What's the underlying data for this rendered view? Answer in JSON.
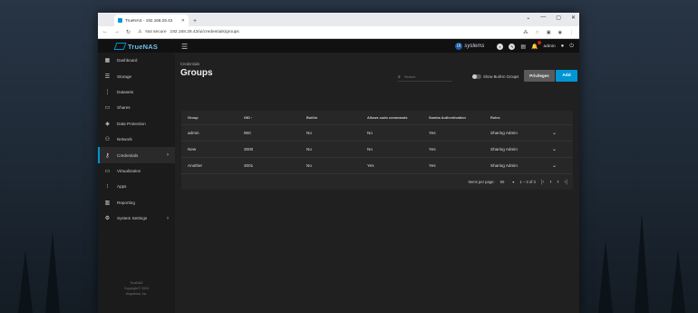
{
  "browser": {
    "tab_title": "TrueNAS - 192.168.29.43",
    "new_tab": "+",
    "window_controls": [
      "⌄",
      "—",
      "▢",
      "✕"
    ],
    "security_label": "Not secure",
    "url": "192.168.29.43/ui/credentials/groups"
  },
  "app": {
    "logo_text": "TrueNAS",
    "brand": "systems",
    "brand_prefix": "iX",
    "user": "admin",
    "accent": "#0095d5"
  },
  "sidebar": {
    "items": [
      {
        "label": "Dashboard",
        "icon": "dashboard-icon"
      },
      {
        "label": "Storage",
        "icon": "storage-icon"
      },
      {
        "label": "Datasets",
        "icon": "datasets-icon"
      },
      {
        "label": "Shares",
        "icon": "shares-icon"
      },
      {
        "label": "Data Protection",
        "icon": "shield-icon"
      },
      {
        "label": "Network",
        "icon": "network-icon"
      },
      {
        "label": "Credentials",
        "icon": "key-icon",
        "active": true
      },
      {
        "label": "Virtualization",
        "icon": "monitor-icon"
      },
      {
        "label": "Apps",
        "icon": "apps-icon"
      },
      {
        "label": "Reporting",
        "icon": "chart-icon"
      },
      {
        "label": "System Settings",
        "icon": "gear-icon"
      }
    ],
    "footer_line1": "TrueNAS",
    "footer_line2": "Copyright © 2024",
    "footer_line3": "iXsystems, Inc."
  },
  "page": {
    "breadcrumb": "Credentials",
    "title": "Groups",
    "search_placeholder": "Search",
    "toggle_label": "Show Built-in Groups",
    "privileges_button": "Privileges",
    "add_button": "Add"
  },
  "table": {
    "columns": [
      "Group",
      "GID",
      "Builtin",
      "Allows sudo commands",
      "Samba Authentication",
      "Roles"
    ],
    "sort_indicator": "↑",
    "rows": [
      [
        "admin",
        "950",
        "No",
        "No",
        "Yes",
        "Sharing Admin"
      ],
      [
        "New",
        "3000",
        "No",
        "No",
        "Yes",
        "Sharing Admin"
      ],
      [
        "Another",
        "3001",
        "No",
        "Yes",
        "Yes",
        "Sharing Admin"
      ]
    ],
    "items_per_page_label": "Items per page:",
    "items_per_page": "50",
    "range": "1 – 3 of 3"
  }
}
